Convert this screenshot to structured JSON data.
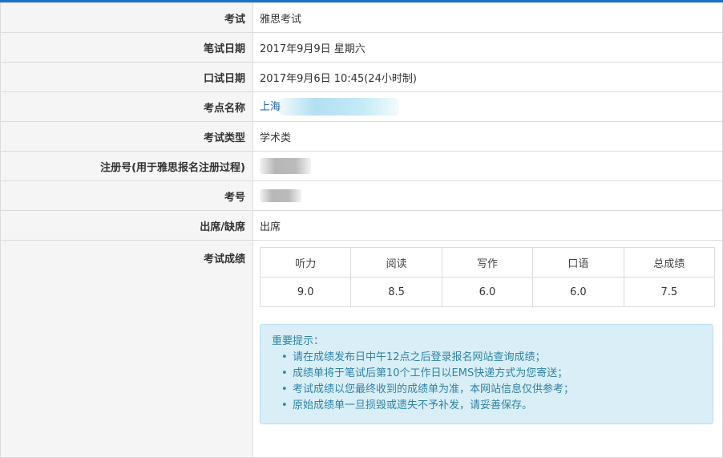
{
  "rows": [
    {
      "label": "考试",
      "value": "雅思考试"
    },
    {
      "label": "笔试日期",
      "value": "2017年9月9日  星期六"
    },
    {
      "label": "口试日期",
      "value": "2017年9月6日 10:45(24小时制)"
    },
    {
      "label": "考点名称",
      "value": "上海"
    },
    {
      "label": "考试类型",
      "value": "学术类"
    },
    {
      "label": "注册号(用于雅思报名注册过程)",
      "value": ""
    },
    {
      "label": "考号",
      "value": ""
    },
    {
      "label": "出席/缺席",
      "value": "出席"
    }
  ],
  "scores": {
    "label": "考试成绩",
    "headers": [
      "听力",
      "阅读",
      "写作",
      "口语",
      "总成绩"
    ],
    "values": [
      "9.0",
      "8.5",
      "6.0",
      "6.0",
      "7.5"
    ]
  },
  "notice": {
    "title": "重要提示：",
    "items": [
      "请在成绩发布日中午12点之后登录报名网站查询成绩；",
      "成绩单将于笔试后第10个工作日以EMS快递方式为您寄送；",
      "考试成绩以您最终收到的成绩单为准，本网站信息仅供参考；",
      "原始成绩单一旦损毁或遗失不予补发，请妥善保存。"
    ]
  },
  "colors": {
    "accent": "#1a73c9",
    "link": "#1a5fa8",
    "notice_bg": "#d9eef6",
    "notice_text": "#2e83a8"
  }
}
